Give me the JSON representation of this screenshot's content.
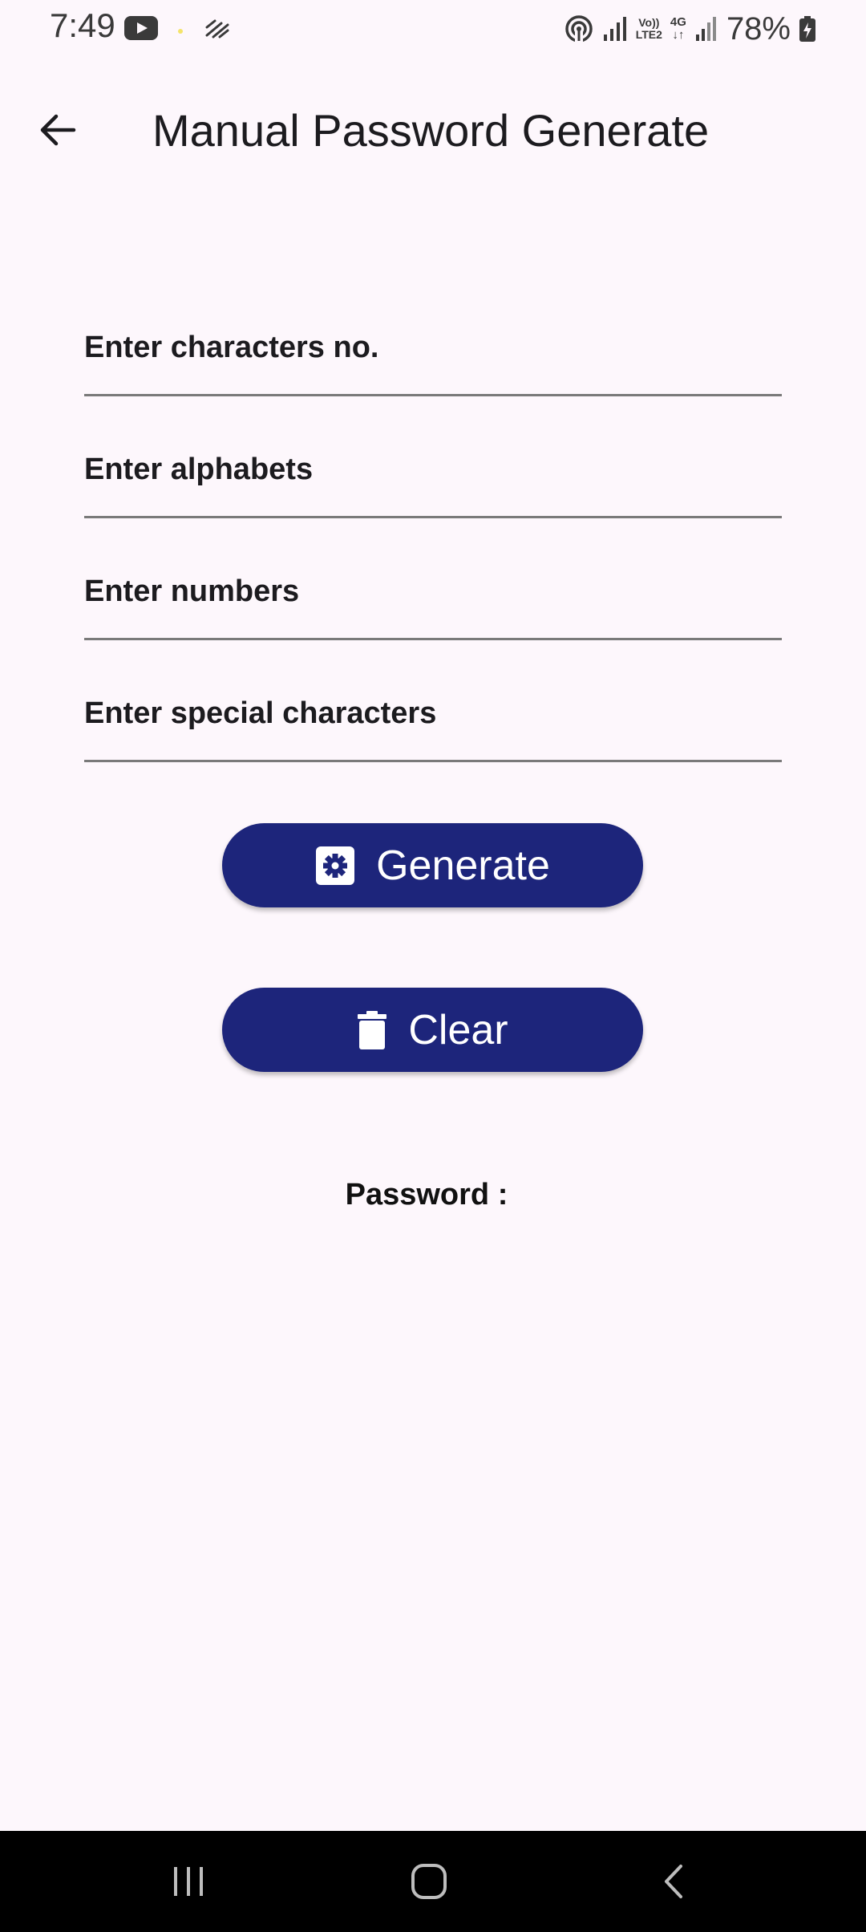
{
  "status_bar": {
    "time": "7:49",
    "network_top": "Vo))",
    "network_bottom": "LTE2",
    "network_4g": "4G",
    "battery": "78%"
  },
  "app_bar": {
    "back_icon": "arrow-left-icon",
    "title": "Manual Password Generate"
  },
  "form": {
    "fields": [
      {
        "placeholder": "Enter characters no."
      },
      {
        "placeholder": "Enter alphabets"
      },
      {
        "placeholder": "Enter numbers"
      },
      {
        "placeholder": "Enter special characters"
      }
    ]
  },
  "buttons": {
    "generate": {
      "label": "Generate",
      "icon": "gear-icon"
    },
    "clear": {
      "label": "Clear",
      "icon": "trash-icon"
    }
  },
  "result": {
    "label": "Password :",
    "value": ""
  },
  "nav_bar": {
    "recents_icon": "recents-icon",
    "home_icon": "home-icon",
    "back_icon": "back-icon"
  },
  "colors": {
    "background": "#fdf7fc",
    "button": "#1d257b",
    "nav_bar": "#000000"
  }
}
